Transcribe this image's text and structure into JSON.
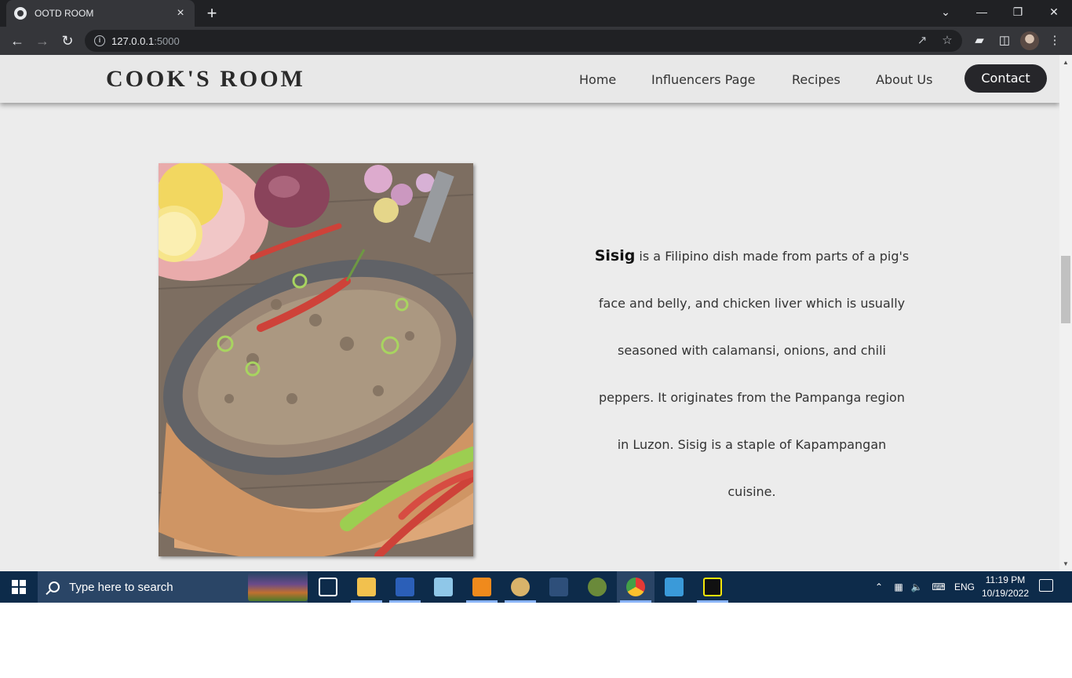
{
  "browser": {
    "tab_title": "OOTD ROOM",
    "tab_close": "×",
    "new_tab": "+",
    "url_host": "127.0.0.1",
    "url_port": ":5000",
    "window_controls": {
      "dropdown": "⌄",
      "minimize": "—",
      "restore": "❐",
      "close": "✕"
    }
  },
  "site": {
    "logo": "COOK'S ROOM",
    "nav": {
      "home": "Home",
      "influencers": "Influencers Page",
      "recipes": "Recipes",
      "about": "About Us",
      "contact": "Contact"
    },
    "dish": {
      "name": "Sisig",
      "description": " is a Filipino dish made from parts of a pig's face and belly, and chicken liver which is usually seasoned with calamansi, onions, and chili peppers. It originates from the Pampanga region in Luzon. Sisig is a staple of Kapampangan cuisine.",
      "image_alt": "Sisig on a sizzling plate"
    }
  },
  "taskbar": {
    "search_placeholder": "Type here to search",
    "language": "ENG",
    "time": "11:19 PM",
    "date": "10/19/2022"
  },
  "colors": {
    "page_bg": "#ececec",
    "header_bg": "#e8e8e8",
    "contact_bg": "#26262a",
    "taskbar_bg": "#0d2b4a",
    "chrome_dark": "#202124",
    "chrome_toolbar": "#35363a"
  }
}
